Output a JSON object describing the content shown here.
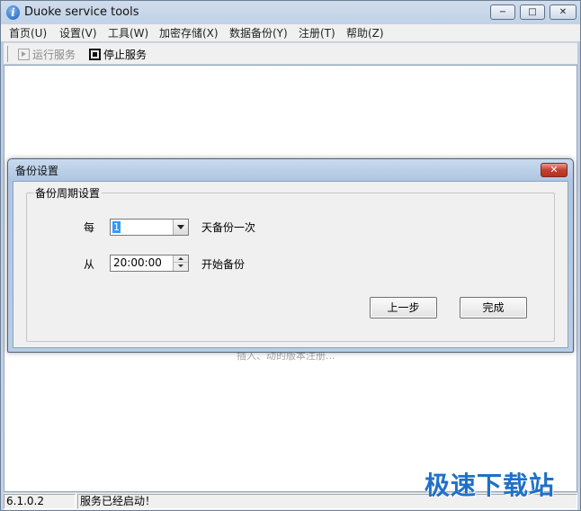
{
  "window": {
    "title": "Duoke service tools",
    "minimize": "−",
    "maximize": "□",
    "close": "✕"
  },
  "menu": [
    "首页(U)",
    "设置(V)",
    "工具(W)",
    "加密存储(X)",
    "数据备份(Y)",
    "注册(T)",
    "帮助(Z)"
  ],
  "toolbar": {
    "run_service": "运行服务",
    "stop_service": "停止服务"
  },
  "background_text": "插入、动的版本注册...",
  "dialog": {
    "title": "备份设置",
    "close": "✕",
    "group_title": "备份周期设置",
    "every_label": "每",
    "every_value": "1",
    "every_suffix": "天备份一次",
    "from_label": "从",
    "from_value": "20:00:00",
    "from_suffix": "开始备份",
    "prev_button": "上一步",
    "finish_button": "完成"
  },
  "status": {
    "version": "6.1.0.2",
    "message": "服务已经启动！"
  },
  "watermark": "极速下载站"
}
